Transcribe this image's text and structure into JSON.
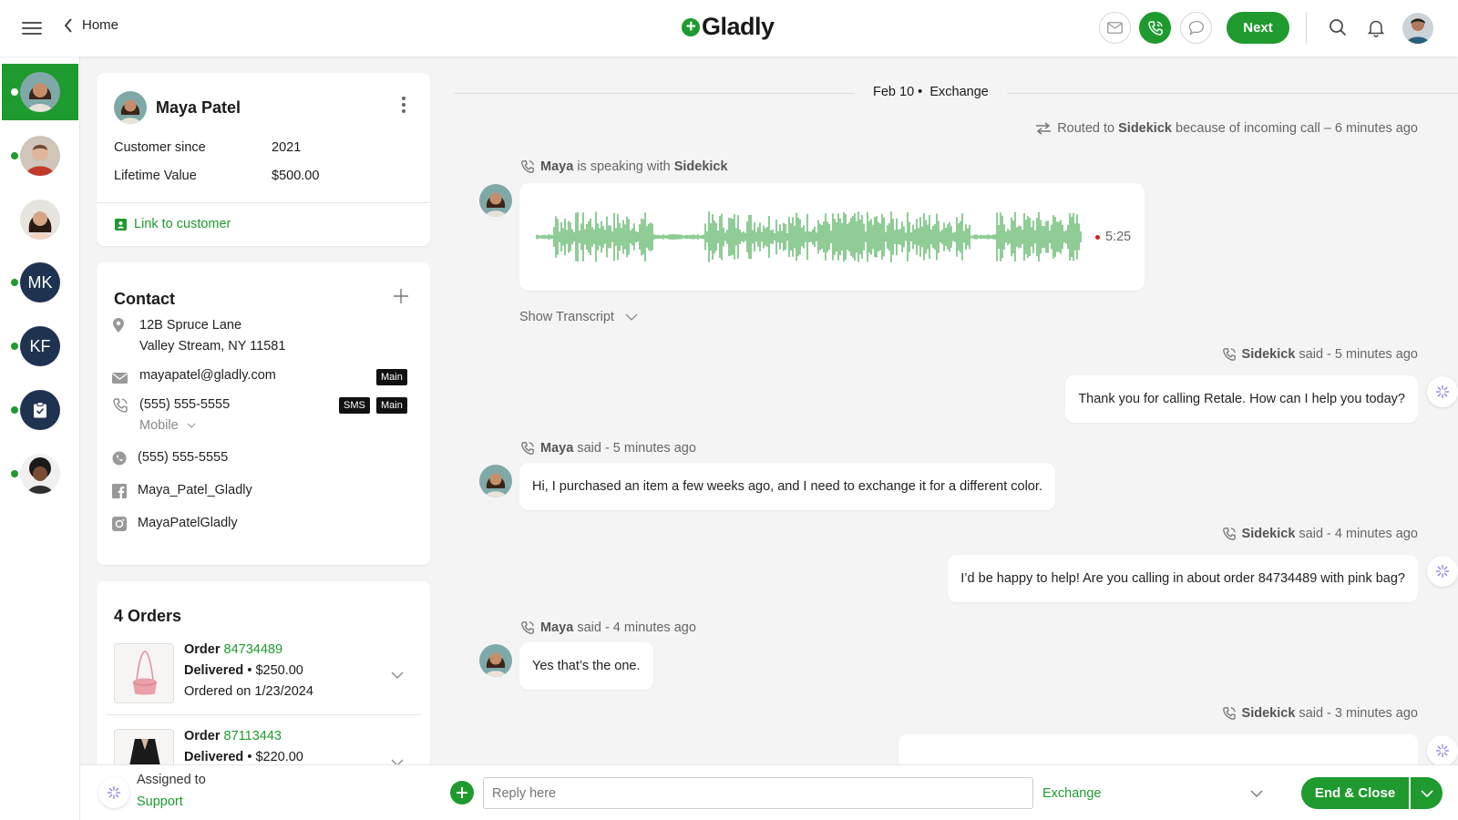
{
  "topbar": {
    "back_label": "Home",
    "logo_text": "Gladly",
    "next_label": "Next"
  },
  "customer": {
    "name": "Maya Patel",
    "since_label": "Customer since",
    "since_value": "2021",
    "ltv_label": "Lifetime Value",
    "ltv_value": "$500.00",
    "link_label": "Link to customer"
  },
  "contact": {
    "title": "Contact",
    "address_line1": "12B Spruce Lane",
    "address_line2": "Valley Stream, NY 11581",
    "email": "mayapatel@gladly.com",
    "email_tag": "Main",
    "phone": "(555) 555-5555",
    "phone_tag_sms": "SMS",
    "phone_tag_main": "Main",
    "phone_type": "Mobile",
    "whatsapp": "(555) 555-5555",
    "facebook": "Maya_Patel_Gladly",
    "instagram": "MayaPatelGladly"
  },
  "orders": {
    "title": "4 Orders",
    "items": [
      {
        "prefix": "Order",
        "number": "84734489",
        "status": "Delivered",
        "price": "$250.00",
        "date": "Ordered on 1/23/2024"
      },
      {
        "prefix": "Order",
        "number": "87113443",
        "status": "Delivered",
        "price": "$220.00"
      }
    ]
  },
  "assigned": {
    "label": "Assigned to",
    "team": "Support"
  },
  "conversation": {
    "date": "Feb 10",
    "topic": "Exchange",
    "routed": {
      "prefix": "Routed to",
      "agent": "Sidekick",
      "suffix": "because of incoming call – 6 minutes ago"
    },
    "speaking": {
      "who": "Maya",
      "mid": "is speaking with",
      "agent": "Sidekick"
    },
    "recording_time": "5:25",
    "show_transcript": "Show Transcript",
    "messages": [
      {
        "who": "Sidekick",
        "meta": "said - 5 minutes ago",
        "text": "Thank you for calling Retale. How can I help you today?"
      },
      {
        "who": "Maya",
        "meta": "said - 5 minutes ago",
        "text": "Hi, I purchased an item a few weeks ago, and I need to exchange it for a different color."
      },
      {
        "who": "Sidekick",
        "meta": "said - 4 minutes ago",
        "text": "I’d be happy to help! Are you calling in about order 84734489 with pink bag?"
      },
      {
        "who": "Maya",
        "meta": "said - 4 minutes ago",
        "text": "Yes that’s the one."
      },
      {
        "who": "Sidekick",
        "meta": "said - 3 minutes ago",
        "text": ""
      }
    ]
  },
  "composer": {
    "placeholder": "Reply here",
    "topic_value": "Exchange",
    "end_label": "End & Close"
  },
  "sidebar": {
    "conversations": [
      {
        "initials": "",
        "active": true
      },
      {
        "initials": ""
      },
      {
        "initials": ""
      },
      {
        "initials": "MK"
      },
      {
        "initials": "KF"
      },
      {
        "initials": ""
      },
      {
        "initials": ""
      }
    ]
  },
  "colors": {
    "accent": "#1f9a2e",
    "navy": "#1e3350",
    "recording_dot": "#d42020"
  },
  "icons": [
    "menu-icon",
    "back-chevron-icon",
    "mail-icon",
    "phone-icon",
    "chat-icon",
    "search-icon",
    "bell-icon",
    "kebab-icon",
    "contact-card-icon",
    "plus-icon",
    "location-pin-icon",
    "envelope-icon",
    "phone-icon",
    "chevron-down-icon",
    "whatsapp-icon",
    "facebook-icon",
    "instagram-icon",
    "route-icon",
    "sidekick-icon",
    "add-circle-icon"
  ]
}
